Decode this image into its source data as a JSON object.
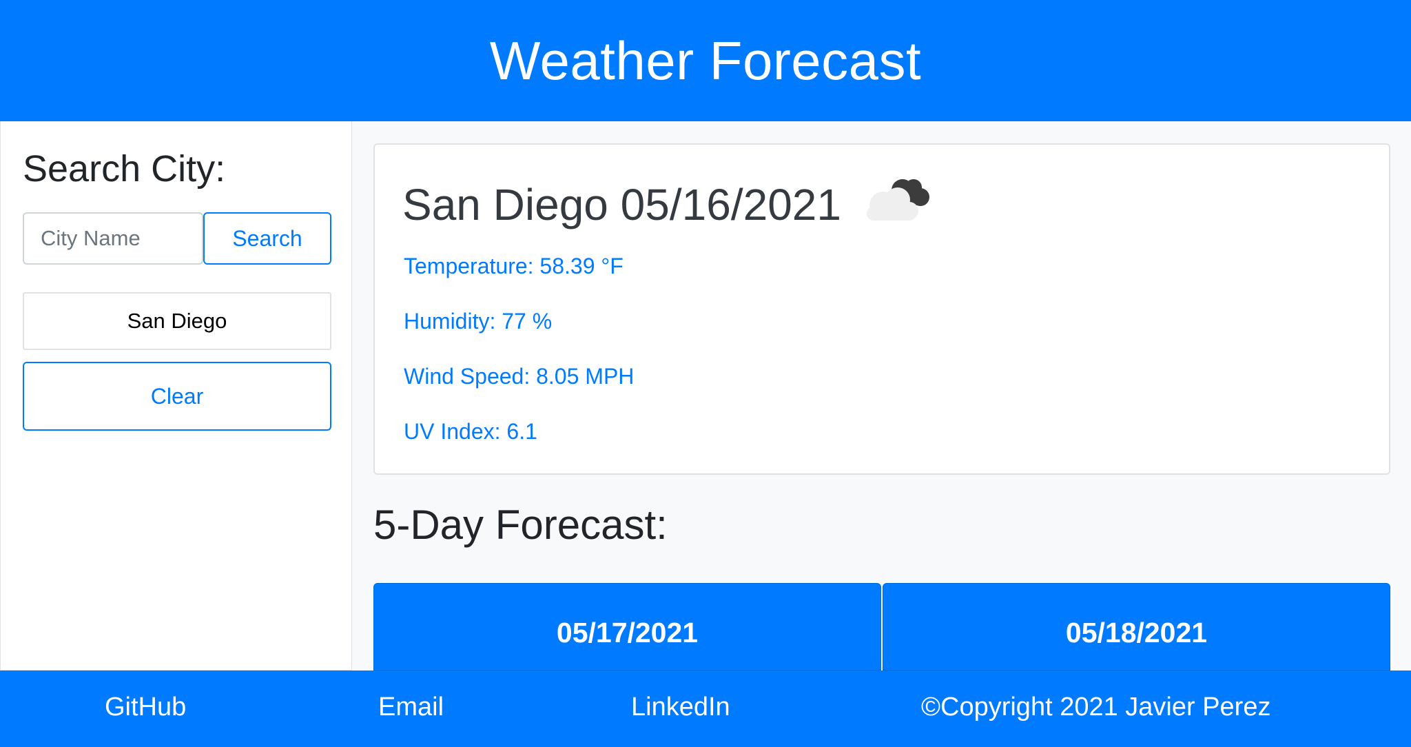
{
  "header": {
    "title": "Weather Forecast"
  },
  "sidebar": {
    "heading": "Search City:",
    "search_placeholder": "City Name",
    "search_button": "Search",
    "history": [
      "San Diego"
    ],
    "clear_button": "Clear"
  },
  "current": {
    "title": "San Diego 05/16/2021",
    "icon": "cloudy-icon",
    "temperature": "Temperature: 58.39 °F",
    "humidity": "Humidity: 77 %",
    "wind": "Wind Speed: 8.05 MPH",
    "uv": "UV Index: 6.1"
  },
  "forecast": {
    "heading": "5-Day Forecast:",
    "days": [
      {
        "date": "05/17/2021"
      },
      {
        "date": "05/18/2021"
      }
    ]
  },
  "footer": {
    "github": "GitHub",
    "email": "Email",
    "linkedin": "LinkedIn",
    "copyright": "©Copyright 2021 Javier Perez"
  },
  "colors": {
    "primary": "#007bff",
    "background": "#f8f9fa"
  }
}
